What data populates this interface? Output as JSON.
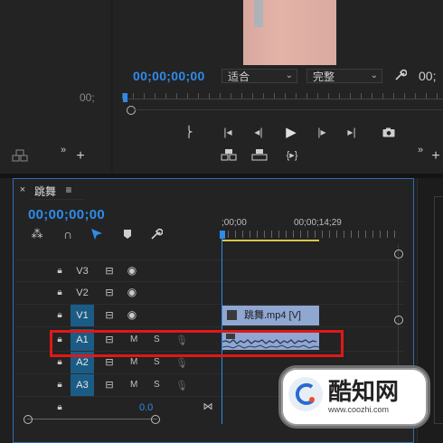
{
  "program_monitor": {
    "timecode_current": "00;00;00;00",
    "fit_label": "适合",
    "quality_label": "完整",
    "timecode_right_partial": "00;",
    "source_timecode_partial": "00;"
  },
  "timeline": {
    "tab_title": "跳舞",
    "timecode": "00;00;00;00",
    "ruler_start": ";00;00",
    "ruler_mark": "00;00;14;29",
    "tracks": [
      {
        "id": "V3",
        "type": "video",
        "target": false
      },
      {
        "id": "V2",
        "type": "video",
        "target": false
      },
      {
        "id": "V1",
        "type": "video",
        "target": true
      },
      {
        "id": "A1",
        "type": "audio",
        "target": true,
        "m": "M",
        "s": "S"
      },
      {
        "id": "A2",
        "type": "audio",
        "target": true,
        "m": "M",
        "s": "S"
      },
      {
        "id": "A3",
        "type": "audio",
        "target": true,
        "m": "M",
        "s": "S"
      }
    ],
    "master_volume": "0.0",
    "clip_label": "跳舞.mp4 [V]"
  },
  "watermark": {
    "brand_name": "酷知网",
    "brand_url": "www.coozhi.com"
  },
  "colors": {
    "accent_blue": "#2d8ceb",
    "highlight_red": "#e01818",
    "clip_video": "#8fa7d1",
    "work_area_yellow": "#d8c54a"
  }
}
